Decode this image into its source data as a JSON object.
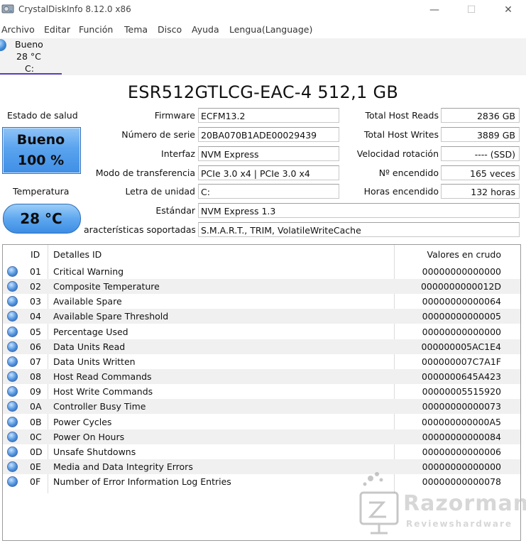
{
  "window": {
    "title": "CrystalDiskInfo 8.12.0 x86",
    "minimize_glyph": "—",
    "maximize_glyph": "☐",
    "close_glyph": "✕"
  },
  "menu": [
    "Archivo",
    "Editar",
    "Función",
    "Tema",
    "Disco",
    "Ayuda",
    "Lengua(Language)"
  ],
  "disk_tab": {
    "status": "Bueno",
    "temp": "28 °C",
    "drive": "C:"
  },
  "model": "ESR512GTLCG-EAC-4 512,1 GB",
  "health": {
    "label": "Estado de salud",
    "status": "Bueno",
    "percent": "100 %"
  },
  "temperature": {
    "label": "Temperatura",
    "value": "28 °C"
  },
  "info_left": {
    "firmware": {
      "label": "Firmware",
      "value": "ECFM13.2"
    },
    "serial": {
      "label": "Número de serie",
      "value": "20BA070B1ADE00029439"
    },
    "interface": {
      "label": "Interfaz",
      "value": "NVM Express"
    },
    "transfer": {
      "label": "Modo de transferencia",
      "value": "PCIe 3.0 x4 | PCIe 3.0 x4"
    },
    "drive_letter": {
      "label": "Letra de unidad",
      "value": "C:"
    },
    "standard": {
      "label": "Estándar",
      "value": "NVM Express 1.3"
    },
    "features": {
      "label": "aracterísticas soportadas",
      "value": "S.M.A.R.T., TRIM, VolatileWriteCache"
    }
  },
  "info_right": {
    "host_reads": {
      "label": "Total Host Reads",
      "value": "2836 GB"
    },
    "host_writes": {
      "label": "Total Host Writes",
      "value": "3889 GB"
    },
    "rotation": {
      "label": "Velocidad rotación",
      "value": "---- (SSD)"
    },
    "power_count": {
      "label": "Nº encendido",
      "value": "165 veces"
    },
    "power_hours": {
      "label": "Horas encendido",
      "value": "132 horas"
    }
  },
  "smart": {
    "headers": {
      "id": "ID",
      "name": "Detalles ID",
      "raw": "Valores en crudo"
    },
    "rows": [
      {
        "id": "01",
        "name": "Critical Warning",
        "raw": "00000000000000"
      },
      {
        "id": "02",
        "name": "Composite Temperature",
        "raw": "0000000000012D"
      },
      {
        "id": "03",
        "name": "Available Spare",
        "raw": "00000000000064"
      },
      {
        "id": "04",
        "name": "Available Spare Threshold",
        "raw": "00000000000005"
      },
      {
        "id": "05",
        "name": "Percentage Used",
        "raw": "00000000000000"
      },
      {
        "id": "06",
        "name": "Data Units Read",
        "raw": "000000005AC1E4"
      },
      {
        "id": "07",
        "name": "Data Units Written",
        "raw": "000000007C7A1F"
      },
      {
        "id": "08",
        "name": "Host Read Commands",
        "raw": "0000000645A423"
      },
      {
        "id": "09",
        "name": "Host Write Commands",
        "raw": "00000005515920"
      },
      {
        "id": "0A",
        "name": "Controller Busy Time",
        "raw": "00000000000073"
      },
      {
        "id": "0B",
        "name": "Power Cycles",
        "raw": "000000000000A5"
      },
      {
        "id": "0C",
        "name": "Power On Hours",
        "raw": "00000000000084"
      },
      {
        "id": "0D",
        "name": "Unsafe Shutdowns",
        "raw": "00000000000006"
      },
      {
        "id": "0E",
        "name": "Media and Data Integrity Errors",
        "raw": "00000000000000"
      },
      {
        "id": "0F",
        "name": "Number of Error Information Log Entries",
        "raw": "00000000000078"
      }
    ]
  },
  "watermark": {
    "brand": "Razorman",
    "tagline": "Reviewshardware"
  },
  "colors": {
    "status_good": "#4a97ea",
    "tab_accent": "#5b3fc4"
  }
}
